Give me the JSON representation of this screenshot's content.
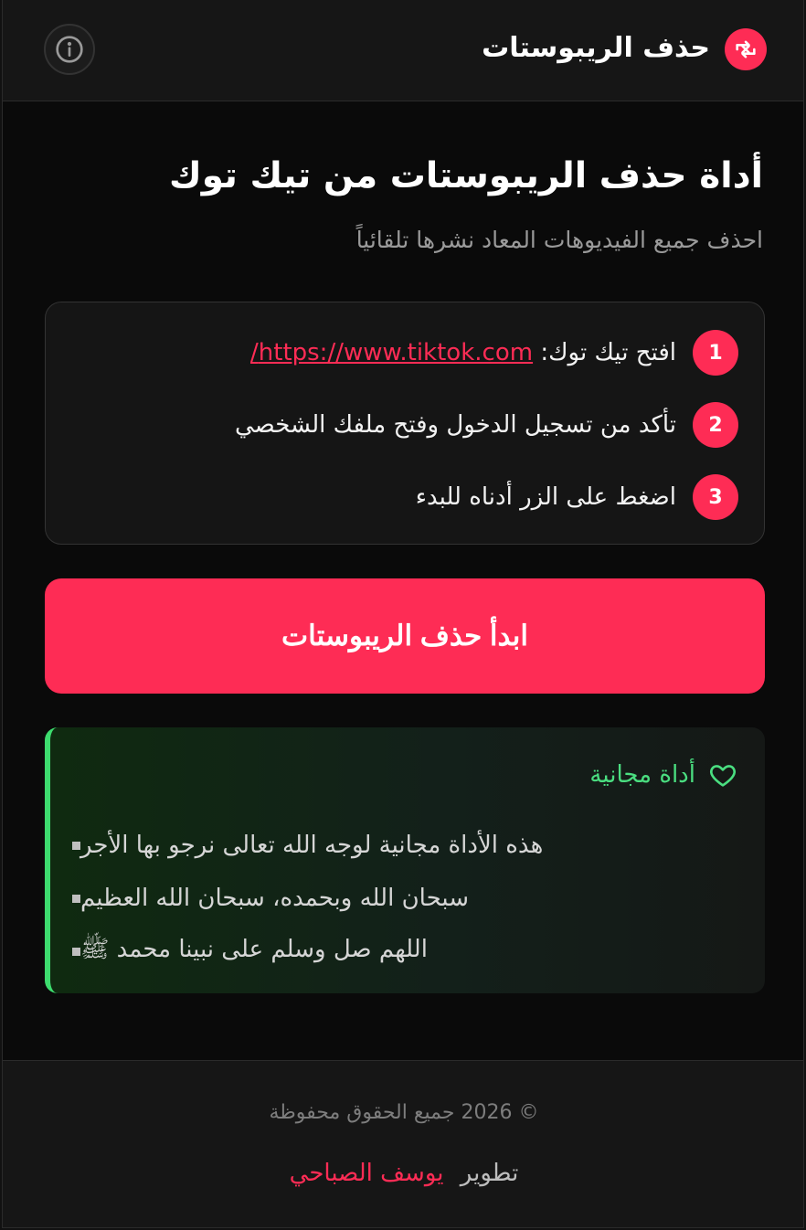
{
  "header": {
    "title": "حذف الريبوستات",
    "logo_icon": "repost-off-icon",
    "info_icon": "info-icon"
  },
  "main": {
    "title": "أداة حذف الريبوستات من تيك توك",
    "subtitle": "احذف جميع الفيديوهات المعاد نشرها تلقائياً"
  },
  "steps": [
    {
      "number": "1",
      "text": "افتح تيك توك:",
      "link": "https://www.tiktok.com/"
    },
    {
      "number": "2",
      "text": "تأكد من تسجيل الدخول وفتح ملفك الشخصي"
    },
    {
      "number": "3",
      "text": "اضغط على الزر أدناه للبدء"
    }
  ],
  "start_button": {
    "label": "ابدأ حذف الريبوستات"
  },
  "free_card": {
    "title": "أداة مجانية",
    "icon": "heart-icon",
    "items": [
      "هذه الأداة مجانية لوجه الله تعالى نرجو بها الأجر",
      "سبحان الله وبحمده، سبحان الله العظيم",
      "اللهم صل وسلم على نبينا محمد ﷺ"
    ]
  },
  "footer": {
    "copyright": "© 2026 جميع الحقوق محفوظة",
    "dev_prefix": "تطوير",
    "dev_name": "يوسف الصباحي"
  },
  "colors": {
    "accent": "#fe2c55",
    "success": "#4ade80",
    "background": "#0a0a0a",
    "panel": "#161616"
  }
}
